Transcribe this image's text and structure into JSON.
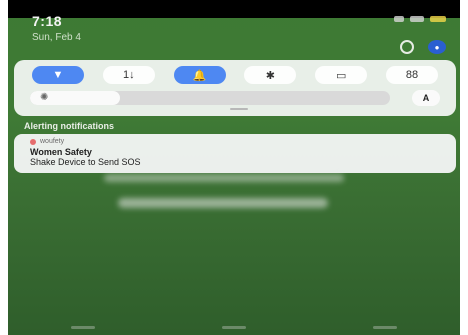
{
  "status": {
    "time": "7:18",
    "date": "Sun, Feb 4"
  },
  "quick_settings": {
    "tiles": [
      {
        "icon": "wifi-icon",
        "glyph": "▼",
        "active": true
      },
      {
        "icon": "data-transfer-icon",
        "glyph": "1↓",
        "active": false
      },
      {
        "icon": "bell-icon",
        "glyph": "🔔",
        "active": true
      },
      {
        "icon": "bluetooth-icon",
        "glyph": "✱",
        "active": false
      },
      {
        "icon": "flashlight-icon",
        "glyph": "▭",
        "active": false
      },
      {
        "icon": "apps-grid-icon",
        "glyph": "88",
        "active": false
      }
    ],
    "brightness_fraction": 0.25,
    "auto_label": "A"
  },
  "section_title": "Alerting notifications",
  "notification": {
    "app_name": "woufety",
    "title": "Women Safety",
    "text": "Shake Device to Send SOS"
  },
  "colors": {
    "active_tile": "#4e88f2",
    "background": "#3d7a34"
  }
}
